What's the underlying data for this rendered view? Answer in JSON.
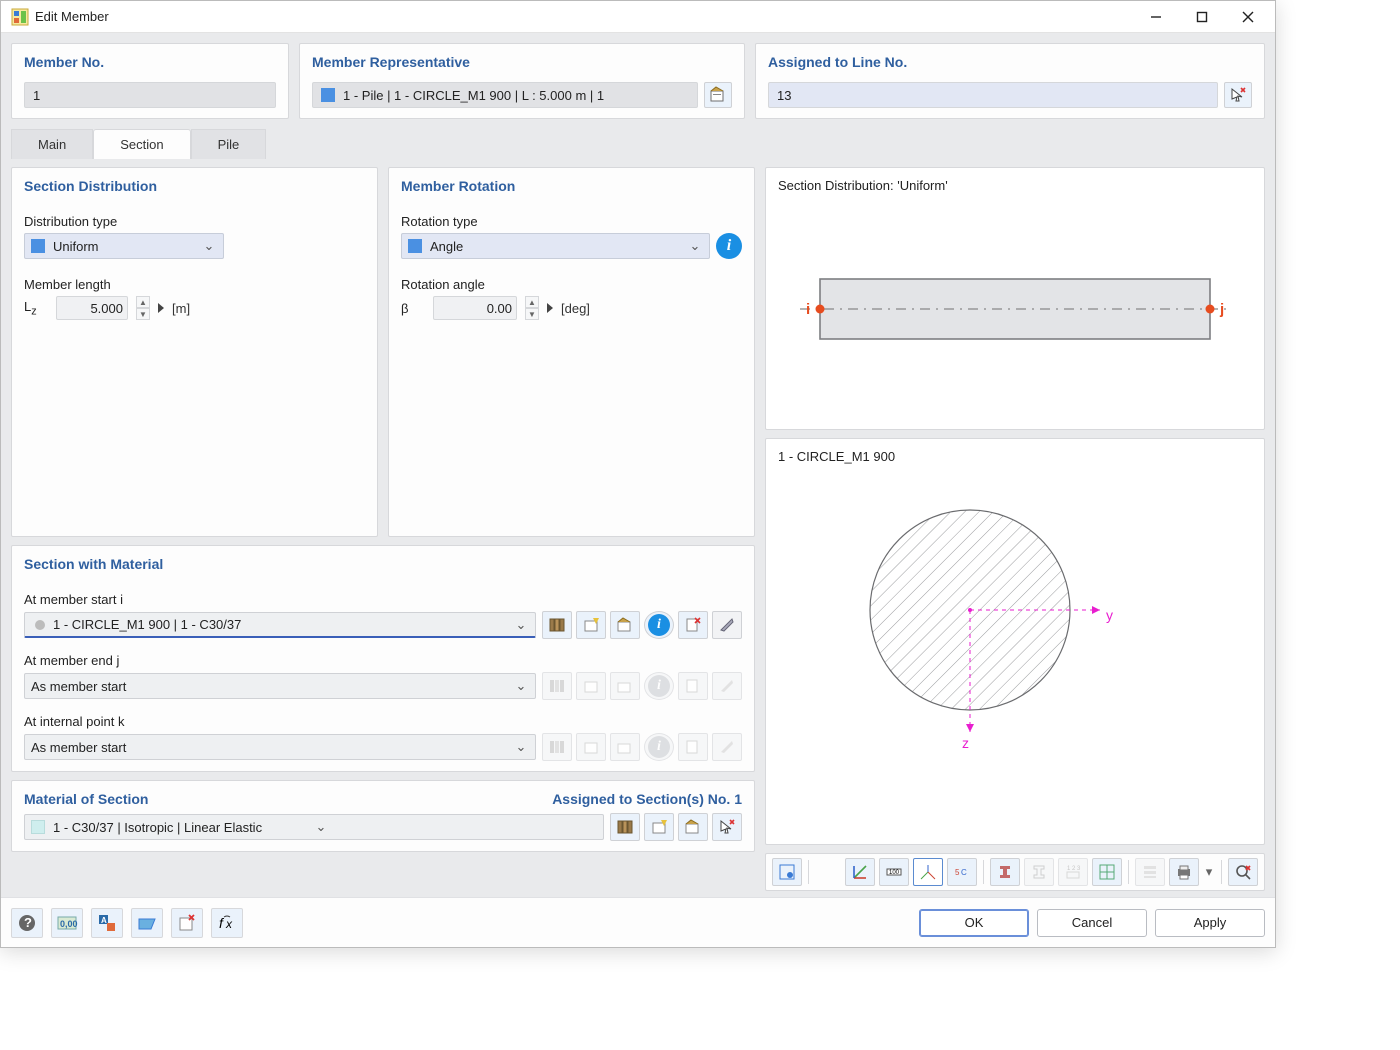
{
  "window": {
    "title": "Edit Member"
  },
  "header": {
    "member_no": {
      "title": "Member No.",
      "value": "1"
    },
    "representative": {
      "title": "Member Representative",
      "value": "1 - Pile | 1 - CIRCLE_M1 900 | L : 5.000 m | 1"
    },
    "assigned_line": {
      "title": "Assigned to Line No.",
      "value": "13"
    }
  },
  "tabs": {
    "main": "Main",
    "section": "Section",
    "pile": "Pile",
    "active": "section"
  },
  "section_dist": {
    "title": "Section Distribution",
    "type_label": "Distribution type",
    "type_value": "Uniform",
    "length_label": "Member length",
    "length_sym": "L",
    "length_sub": "z",
    "length_value": "5.000",
    "length_unit": "[m]"
  },
  "rotation": {
    "title": "Member Rotation",
    "type_label": "Rotation type",
    "type_value": "Angle",
    "angle_label": "Rotation angle",
    "angle_sym": "β",
    "angle_value": "0.00",
    "angle_unit": "[deg]"
  },
  "section_mat": {
    "title": "Section with Material",
    "start_label": "At member start i",
    "start_value": "1 - CIRCLE_M1 900 | 1 - C30/37",
    "end_label": "At member end j",
    "end_value": "As member start",
    "internal_label": "At internal point k",
    "internal_value": "As member start"
  },
  "material": {
    "title": "Material of Section",
    "assigned": "Assigned to Section(s) No. 1",
    "value": "1 - C30/37 | Isotropic | Linear Elastic"
  },
  "preview": {
    "dist_title": "Section Distribution: 'Uniform'",
    "i": "i",
    "j": "j",
    "section_title": "1 - CIRCLE_M1 900",
    "y": "y",
    "z": "z"
  },
  "footer": {
    "ok": "OK",
    "cancel": "Cancel",
    "apply": "Apply"
  }
}
